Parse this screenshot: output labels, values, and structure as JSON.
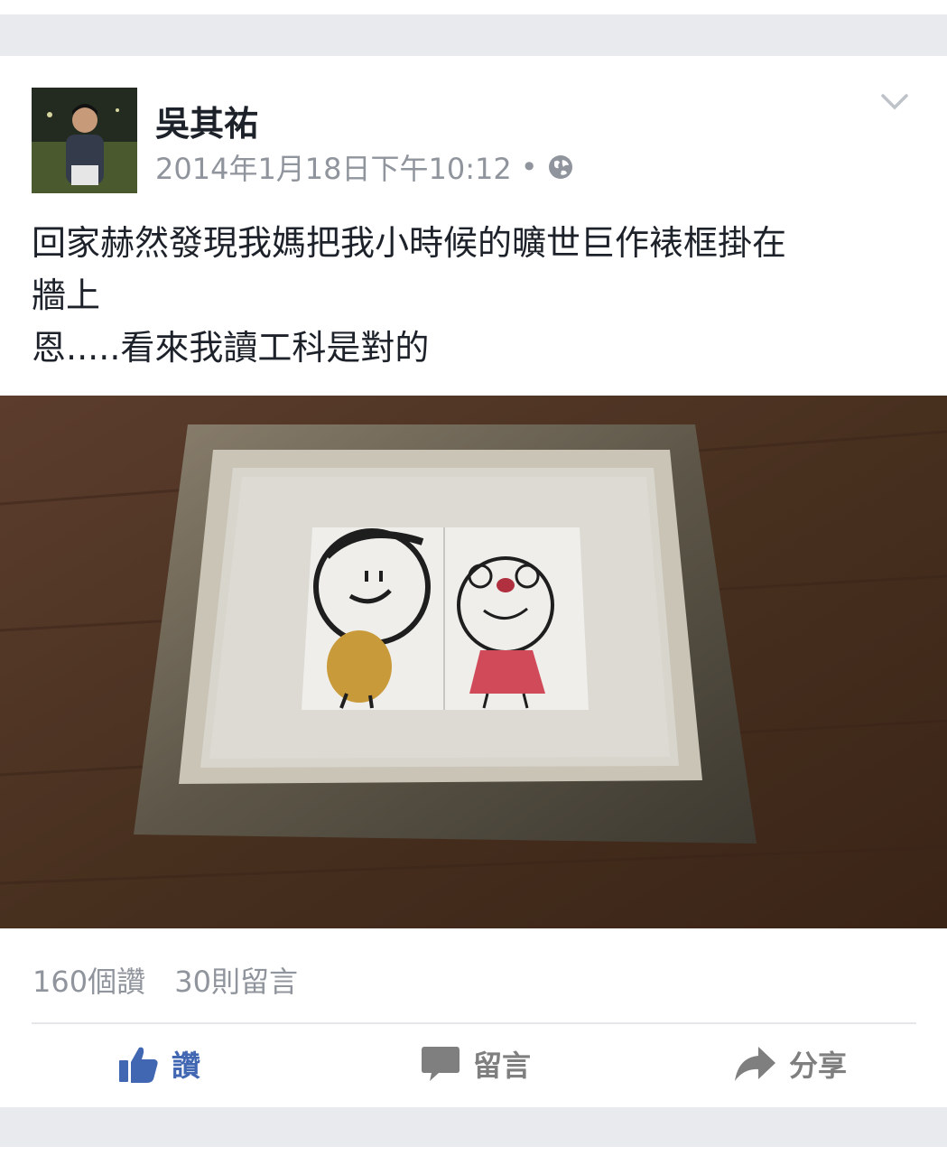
{
  "post": {
    "author": "吳其祐",
    "timestamp": "2014年1月18日下午10:12",
    "separator": "•",
    "privacy_icon": "globe-icon",
    "menu_icon": "chevron-down-icon",
    "text_lines": [
      "回家赫然發現我媽把我小時候的曠世巨作裱框掛在",
      "牆上",
      "恩.....看來我讀工科是對的"
    ]
  },
  "stats": {
    "likes": "160個讚",
    "comments": "30則留言"
  },
  "actions": {
    "like_label": "讚",
    "comment_label": "留言",
    "share_label": "分享"
  },
  "colors": {
    "accent": "#4267b2",
    "secondary_text": "#90949c",
    "background_band": "#e9eaee"
  }
}
